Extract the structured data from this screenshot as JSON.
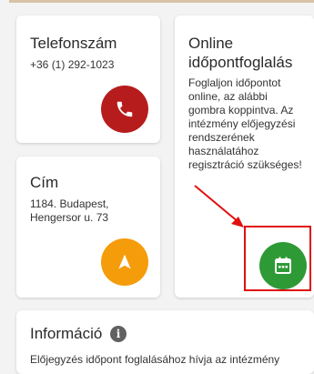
{
  "phone_card": {
    "title": "Telefonszám",
    "number": "+36 (1) 292-1023",
    "button_icon": "phone-icon",
    "button_color": "#b71c1c"
  },
  "address_card": {
    "title": "Cím",
    "line1": "1184. Budapest,",
    "line2": "Hengersor u. 73",
    "button_icon": "navigation-arrow-icon",
    "button_color": "#f59c0a"
  },
  "online_card": {
    "title_line1": "Online",
    "title_line2": "időpontfoglalás",
    "text_lines": [
      "Foglaljon időpontot",
      "online, az alábbi",
      "gombra koppintva. Az",
      "intézmény előjegyzési",
      "rendszerének",
      "használatához",
      "regisztráció szükséges!"
    ],
    "button_icon": "calendar-icon",
    "button_color": "#2e9a36",
    "highlight_color": "#e01010"
  },
  "info_card": {
    "title": "Információ",
    "icon": "info-icon",
    "text": "Előjegyzés időpont foglalásához hívja az intézmény"
  }
}
